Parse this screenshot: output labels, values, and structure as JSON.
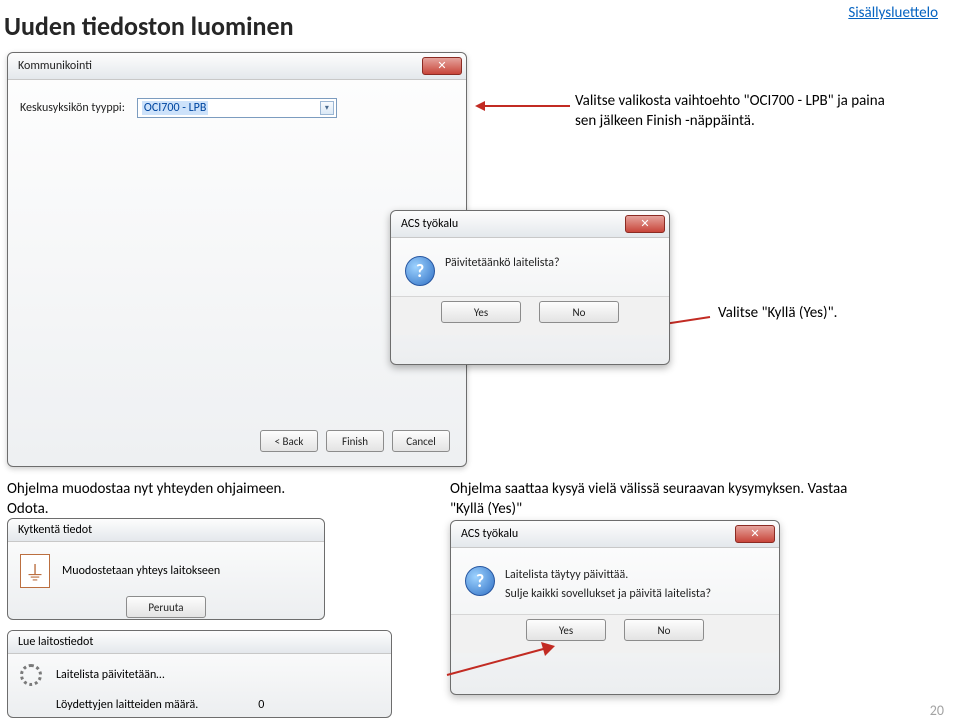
{
  "page": {
    "title": "Uuden tiedoston luominen",
    "toc_link": "Sisällysluettelo",
    "page_number": "20"
  },
  "dialog1": {
    "title": "Kommunikointi",
    "close": "✕",
    "field_label": "Keskusyksikön tyyppi:",
    "selected": "OCI700 - LPB",
    "back": "< Back",
    "finish": "Finish",
    "cancel": "Cancel"
  },
  "caption1": "Valitse valikosta vaihtoehto \"OCI700 - LPB\" ja paina sen jälkeen Finish -näppäintä.",
  "dialog2": {
    "title": "ACS työkalu",
    "close": "✕",
    "message": "Päivitetäänkö laitelista?",
    "yes": "Yes",
    "no": "No"
  },
  "caption2": "Valitse \"Kyllä (Yes)\".",
  "caption3_line1": "Ohjelma muodostaa nyt yhteyden ohjaimeen.",
  "caption3_line2": "Odota.",
  "dialog3": {
    "title": "Kytkentä tiedot",
    "message": "Muodostetaan yhteys laitokseen",
    "cancel": "Peruuta"
  },
  "dialog4": {
    "title": "Lue laitostiedot",
    "line1": "Laitelista päivitetään…",
    "line2_label": "Löydettyjen laitteiden määrä.",
    "line2_value": "0"
  },
  "caption4": "Ohjelma saattaa kysyä vielä välissä seuraavan kysymyksen. Vastaa \"Kyllä (Yes)\"",
  "dialog5": {
    "title": "ACS työkalu",
    "close": "✕",
    "line1": "Laitelista täytyy päivittää.",
    "line2": "Sulje kaikki sovellukset ja päivitä laitelista?",
    "yes": "Yes",
    "no": "No"
  }
}
